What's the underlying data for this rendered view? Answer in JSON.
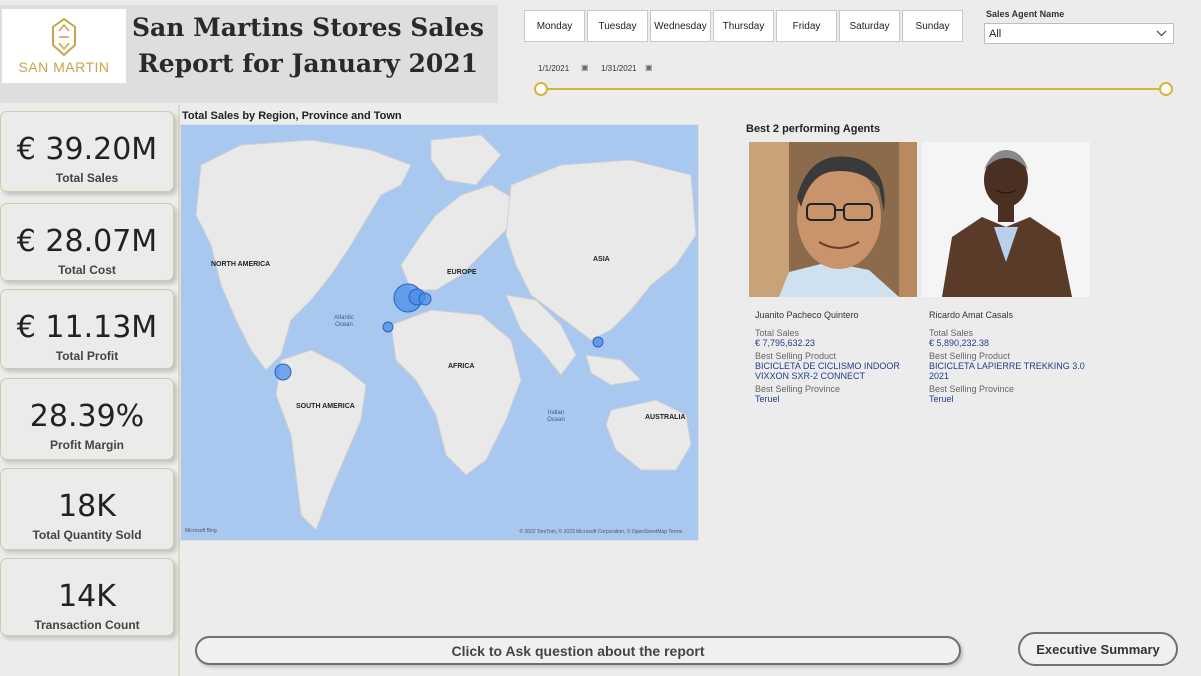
{
  "header": {
    "logo_text": "SAN MARTIN",
    "title": "San Martins Stores Sales Report for January 2021"
  },
  "days": [
    "Monday",
    "Tuesday",
    "Wednesday",
    "Thursday",
    "Friday",
    "Saturday",
    "Sunday"
  ],
  "agent_filter": {
    "label": "Sales Agent Name",
    "value": "All"
  },
  "date_range": {
    "start": "1/1/2021",
    "end": "1/31/2021"
  },
  "kpis": [
    {
      "value": "€ 39.20M",
      "label": "Total Sales"
    },
    {
      "value": "€ 28.07M",
      "label": "Total Cost"
    },
    {
      "value": "€ 11.13M",
      "label": "Total Profit"
    },
    {
      "value": "28.39%",
      "label": "Profit Margin"
    },
    {
      "value": "18K",
      "label": "Total Quantity Sold"
    },
    {
      "value": "14K",
      "label": "Transaction Count"
    }
  ],
  "map": {
    "title": "Total Sales by Region, Province and Town",
    "labels": {
      "north_america": "NORTH AMERICA",
      "europe": "EUROPE",
      "asia": "ASIA",
      "africa": "AFRICA",
      "south_america": "SOUTH AMERICA",
      "australia": "AUSTRALIA",
      "atlantic": "Atlantic Ocean",
      "indian": "Indian Ocean"
    },
    "credit": "© 2022 TomTom, © 2023 Microsoft Corporation, © OpenStreetMap Terms",
    "bing": "Microsoft Bing"
  },
  "agents": {
    "title": "Best 2 performing Agents",
    "list": [
      {
        "name": "Juanito Pacheco Quintero",
        "sales_label": "Total Sales",
        "sales": "€ 7,795,632.23",
        "product_label": "Best Selling Product",
        "product": "BICICLETA DE CICLISMO INDOOR VIXXON SXR-2 CONNECT",
        "province_label": "Best Selling Province",
        "province": "Teruel"
      },
      {
        "name": "Ricardo Amat Casals",
        "sales_label": "Total Sales",
        "sales": "€ 5,890,232.38",
        "product_label": "Best Selling Product",
        "product": "BICICLETA LAPIERRE TREKKING 3.0 2021",
        "province_label": "Best Selling Province",
        "province": "Teruel"
      }
    ]
  },
  "buttons": {
    "ask": "Click to Ask question about the report",
    "executive": "Executive Summary"
  }
}
